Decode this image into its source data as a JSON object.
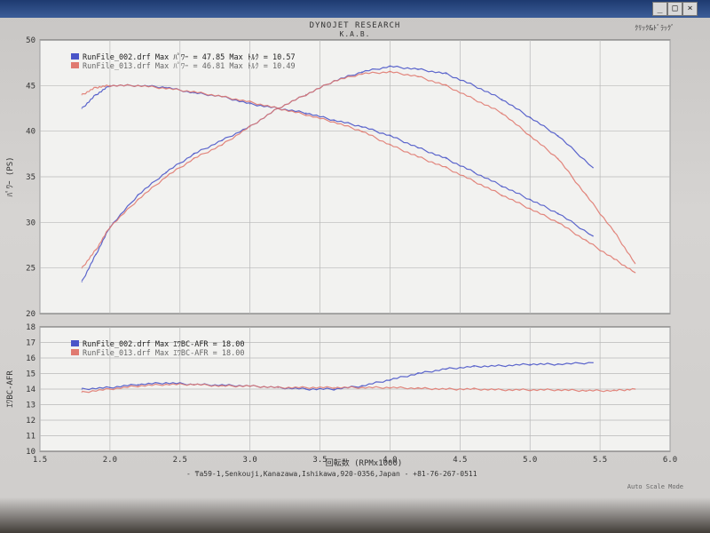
{
  "window": {
    "buttons": [
      "_",
      "□",
      "×"
    ]
  },
  "header": {
    "title": "DYNOJET RESEARCH",
    "subtitle": "K.A.B.",
    "right": "ｸﾘｯｸ&ﾄﾞﾗｯｸﾞ"
  },
  "footer": {
    "address": "- ₸a59-1,Senkouji,Kanazawa,Ishikawa,920-0356,Japan - +81-76-267-0511",
    "right": "Auto Scale Mode"
  },
  "colors": {
    "series_blue": "#4a55c8",
    "series_red": "#e07a70",
    "grid": "#b8b8b8",
    "panel": "#f2f2f0"
  },
  "chart_data": [
    {
      "type": "line",
      "panel": "top",
      "ylabel": "ﾊﾟﾜｰ (PS)",
      "xlim": [
        1.5,
        6.0
      ],
      "ylim": [
        20,
        50
      ],
      "yticks": [
        "20",
        "25",
        "30",
        "35",
        "40",
        "45",
        "50"
      ],
      "legend": [
        "RunFile_002.drf Max ﾊﾟﾜｰ = 47.85  Max ﾄﾙｸ = 10.57",
        "RunFile_013.drf Max ﾊﾟﾜｰ = 46.81  Max ﾄﾙｸ = 10.49"
      ],
      "grid": true,
      "legend_position": "top-left",
      "series": [
        {
          "name": "RunFile_002.drf",
          "kind": "power",
          "color": "#4a55c8",
          "x": [
            1.8,
            1.9,
            2.0,
            2.2,
            2.4,
            2.6,
            2.8,
            3.0,
            3.2,
            3.4,
            3.6,
            3.8,
            4.0,
            4.2,
            4.4,
            4.6,
            4.8,
            5.0,
            5.2,
            5.45
          ],
          "values": [
            23.5,
            26.5,
            29.5,
            33,
            35.5,
            37.5,
            39,
            40.5,
            42.5,
            44,
            45.5,
            46.5,
            47.1,
            46.8,
            46.3,
            45,
            43.5,
            41.5,
            39.5,
            36
          ]
        },
        {
          "name": "RunFile_013.drf",
          "kind": "power",
          "color": "#e07a70",
          "x": [
            1.8,
            1.9,
            2.0,
            2.2,
            2.4,
            2.6,
            2.8,
            3.0,
            3.2,
            3.4,
            3.6,
            3.8,
            4.0,
            4.2,
            4.4,
            4.6,
            4.8,
            5.0,
            5.2,
            5.4,
            5.6,
            5.75
          ],
          "values": [
            25,
            27,
            29.5,
            32.5,
            35,
            37,
            38.5,
            40.5,
            42.5,
            44,
            45.5,
            46.3,
            46.5,
            46,
            45,
            43.5,
            42,
            39.5,
            37,
            33,
            29,
            25.5
          ]
        },
        {
          "name": "RunFile_002.drf",
          "kind": "torque",
          "color": "#4a55c8",
          "x": [
            1.8,
            1.9,
            2.0,
            2.2,
            2.4,
            2.6,
            2.8,
            3.0,
            3.2,
            3.4,
            3.6,
            3.8,
            4.0,
            4.2,
            4.4,
            4.6,
            4.8,
            5.0,
            5.2,
            5.45
          ],
          "values": [
            42.5,
            44,
            45,
            45,
            44.8,
            44.2,
            43.8,
            43,
            42.5,
            42,
            41.2,
            40.5,
            39.5,
            38.2,
            37,
            35.5,
            34,
            32.5,
            31,
            28.5
          ]
        },
        {
          "name": "RunFile_013.drf",
          "kind": "torque",
          "color": "#e07a70",
          "x": [
            1.8,
            1.9,
            2.0,
            2.2,
            2.4,
            2.6,
            2.8,
            3.0,
            3.2,
            3.4,
            3.6,
            3.8,
            4.0,
            4.2,
            4.4,
            4.6,
            4.8,
            5.0,
            5.2,
            5.4,
            5.6,
            5.75
          ],
          "values": [
            44,
            44.8,
            45,
            45,
            44.7,
            44.3,
            43.8,
            43.2,
            42.5,
            41.8,
            41,
            40,
            38.5,
            37.2,
            36,
            34.5,
            33,
            31.5,
            30,
            28,
            26,
            24.5
          ]
        }
      ]
    },
    {
      "type": "line",
      "panel": "bottom",
      "xlabel": "回転数 (RPMx1000)",
      "ylabel": "ｴﾜBC-AFR",
      "xlim": [
        1.5,
        6.0
      ],
      "ylim": [
        10,
        18
      ],
      "xticks": [
        "1.5",
        "2.0",
        "2.5",
        "3.0",
        "3.5",
        "4.0",
        "4.5",
        "5.0",
        "5.5",
        "6.0"
      ],
      "yticks": [
        "10",
        "11",
        "12",
        "13",
        "14",
        "15",
        "16",
        "17",
        "18"
      ],
      "legend": [
        "RunFile_002.drf Max ｴﾜBC-AFR = 18.00",
        "RunFile_013.drf Max ｴﾜBC-AFR = 18.00"
      ],
      "grid": true,
      "legend_position": "top-left",
      "series": [
        {
          "name": "RunFile_002.drf",
          "color": "#4a55c8",
          "x": [
            1.8,
            2.0,
            2.2,
            2.4,
            2.6,
            2.8,
            3.0,
            3.2,
            3.4,
            3.6,
            3.8,
            4.0,
            4.2,
            4.4,
            4.6,
            4.8,
            5.0,
            5.2,
            5.45
          ],
          "values": [
            14.0,
            14.1,
            14.3,
            14.4,
            14.3,
            14.25,
            14.2,
            14.1,
            14.0,
            14.0,
            14.2,
            14.6,
            15.0,
            15.3,
            15.45,
            15.5,
            15.6,
            15.6,
            15.7
          ]
        },
        {
          "name": "RunFile_013.drf",
          "color": "#e07a70",
          "x": [
            1.8,
            2.0,
            2.2,
            2.4,
            2.6,
            2.8,
            3.0,
            3.2,
            3.4,
            3.6,
            3.8,
            4.0,
            4.2,
            4.4,
            4.6,
            4.8,
            5.0,
            5.2,
            5.4,
            5.6,
            5.75
          ],
          "values": [
            13.8,
            14.0,
            14.2,
            14.3,
            14.3,
            14.2,
            14.2,
            14.1,
            14.1,
            14.1,
            14.1,
            14.1,
            14.05,
            14.0,
            14.0,
            13.95,
            13.95,
            13.95,
            13.9,
            13.9,
            14.0
          ]
        }
      ]
    }
  ]
}
